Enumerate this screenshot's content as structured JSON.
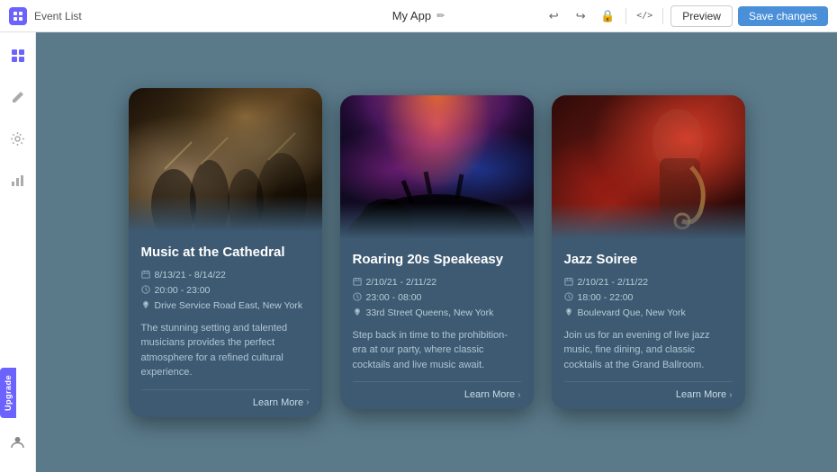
{
  "topbar": {
    "logo_label": "Event List",
    "app_name": "My App",
    "edit_icon": "✏",
    "undo_icon": "↩",
    "redo_icon": "↪",
    "lock_icon": "🔒",
    "code_icon": "</>",
    "preview_label": "Preview",
    "save_label": "Save changes"
  },
  "sidebar": {
    "items": [
      {
        "icon": "⊞",
        "name": "grid-icon",
        "label": "Grid"
      },
      {
        "icon": "✎",
        "name": "edit-icon",
        "label": "Edit"
      },
      {
        "icon": "⚙",
        "name": "settings-icon",
        "label": "Settings"
      },
      {
        "icon": "📊",
        "name": "analytics-icon",
        "label": "Analytics"
      }
    ],
    "upgrade_label": "Upgrade",
    "user_icon": "👤"
  },
  "events": [
    {
      "id": "music-cathedral",
      "title": "Music at the Cathedral",
      "date": "8/13/21 - 8/14/22",
      "time": "20:00 - 23:00",
      "location": "Drive Service Road East, New York",
      "description": "The stunning setting and talented musicians provides the perfect atmosphere for a refined cultural experience.",
      "learn_more_label": "Learn More",
      "image_type": "orchestra"
    },
    {
      "id": "roaring-20s",
      "title": "Roaring 20s Speakeasy",
      "date": "2/10/21 - 2/11/22",
      "time": "23:00 - 08:00",
      "location": "33rd Street Queens, New York",
      "description": "Step back in time to the prohibition-era at our party, where classic cocktails and live music await.",
      "learn_more_label": "Learn More",
      "image_type": "club"
    },
    {
      "id": "jazz-soiree",
      "title": "Jazz Soiree",
      "date": "2/10/21 - 2/11/22",
      "time": "18:00 - 22:00",
      "location": "Boulevard Que, New York",
      "description": "Join us for an evening of live jazz music, fine dining, and classic cocktails at the Grand Ballroom.",
      "learn_more_label": "Learn More",
      "image_type": "jazz"
    }
  ],
  "icons": {
    "calendar": "🗓",
    "clock": "🕐",
    "location": "📍",
    "chevron_right": "›"
  }
}
